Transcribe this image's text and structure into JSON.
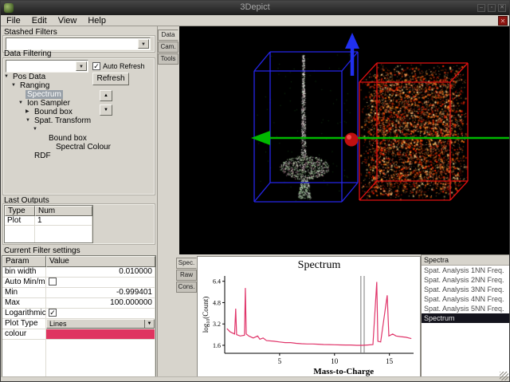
{
  "window": {
    "title": "3Depict"
  },
  "menu": {
    "items": [
      "File",
      "Edit",
      "View",
      "Help"
    ]
  },
  "icons": {
    "close": "✕",
    "minimize": "–",
    "maximize": "▫",
    "dropdown": "▼",
    "up": "▲",
    "down": "▼",
    "check": "✓",
    "tree_expanded": "▼",
    "tree_collapsed": "▶"
  },
  "left_panel": {
    "stashed_filters": {
      "label": "Stashed Filters"
    },
    "data_filtering": {
      "label": "Data Filtering",
      "auto_refresh_label": "Auto Refresh",
      "auto_refresh_checked": true,
      "refresh_label": "Refresh"
    },
    "tree": {
      "items": [
        {
          "label": "Pos Data",
          "indent": 0,
          "arrow": "down",
          "selected": false
        },
        {
          "label": "Ranging",
          "indent": 1,
          "arrow": "down",
          "selected": false
        },
        {
          "label": "Spectrum",
          "indent": 2,
          "arrow": "none",
          "selected": true
        },
        {
          "label": "Ion Sampler",
          "indent": 2,
          "arrow": "down",
          "selected": false
        },
        {
          "label": "Bound box",
          "indent": 3,
          "arrow": "right",
          "selected": false
        },
        {
          "label": "Spat. Transform",
          "indent": 3,
          "arrow": "down",
          "selected": false
        },
        {
          "label": "",
          "indent": 4,
          "arrow": "down",
          "selected": false
        },
        {
          "label": "Bound box",
          "indent": 5,
          "arrow": "none",
          "selected": false
        },
        {
          "label": "Spectral Colour",
          "indent": 6,
          "arrow": "none",
          "selected": false
        },
        {
          "label": "RDF",
          "indent": 3,
          "arrow": "none",
          "selected": false
        }
      ]
    },
    "last_outputs": {
      "label": "Last Outputs",
      "columns": [
        "Type",
        "Num"
      ],
      "rows": [
        [
          "Plot",
          "1"
        ]
      ]
    },
    "filter_settings": {
      "label": "Current Filter settings",
      "columns": [
        "Param",
        "Value"
      ],
      "rows": [
        {
          "param": "bin width",
          "type": "text",
          "value": "0.010000"
        },
        {
          "param": "Auto Min/max",
          "type": "checkbox",
          "checked": false
        },
        {
          "param": "Min",
          "type": "text",
          "value": "-0.999401"
        },
        {
          "param": "Max",
          "type": "text",
          "value": "100.000000"
        },
        {
          "param": "Logarithmic",
          "type": "checkbox",
          "checked": true
        },
        {
          "param": "Plot Type",
          "type": "dropdown",
          "value": "Lines"
        },
        {
          "param": "colour",
          "type": "color",
          "color": "#df3560"
        }
      ]
    }
  },
  "right_tabs": {
    "items": [
      "Data",
      "Cam.",
      "Tools"
    ],
    "active": "Data"
  },
  "plot_tabs": {
    "items": [
      "Spec.",
      "Raw",
      "Cons."
    ],
    "active": "Spec."
  },
  "spectra_panel": {
    "header": "Spectra",
    "items": [
      "Spat. Analysis 1NN Freq.",
      "Spat. Analysis 2NN Freq.",
      "Spat. Analysis 3NN Freq.",
      "Spat. Analysis 4NN Freq.",
      "Spat. Analysis 5NN Freq."
    ],
    "selected": "Spectrum"
  },
  "chart_data": {
    "type": "line",
    "title": "Spectrum",
    "xlabel": "Mass-to-Charge",
    "ylabel": {
      "prefix": "log",
      "sub": "10",
      "suffix": "(Count)"
    },
    "xlim": [
      0,
      17.2
    ],
    "ylim": [
      1.0,
      6.8
    ],
    "xticks": [
      5,
      10,
      15
    ],
    "yticks": [
      1.6,
      3.2,
      4.8,
      6.4
    ],
    "line_color": "#e0356a",
    "cursor_lines": [
      12.4,
      12.7
    ],
    "series": [
      {
        "name": "Spectrum",
        "points": [
          [
            0.2,
            2.85
          ],
          [
            0.5,
            2.6
          ],
          [
            0.9,
            2.45
          ],
          [
            1.0,
            4.35
          ],
          [
            1.08,
            2.4
          ],
          [
            1.4,
            2.3
          ],
          [
            1.8,
            2.35
          ],
          [
            1.88,
            5.9
          ],
          [
            1.96,
            2.45
          ],
          [
            2.2,
            2.3
          ],
          [
            2.6,
            2.15
          ],
          [
            3.0,
            2.3
          ],
          [
            3.2,
            2.05
          ],
          [
            3.5,
            2.15
          ],
          [
            3.8,
            1.95
          ],
          [
            4.5,
            1.9
          ],
          [
            5.0,
            1.85
          ],
          [
            5.5,
            1.8
          ],
          [
            6.0,
            1.8
          ],
          [
            6.5,
            1.75
          ],
          [
            7.0,
            1.72
          ],
          [
            7.5,
            1.7
          ],
          [
            8.0,
            1.7
          ],
          [
            8.5,
            1.68
          ],
          [
            9.0,
            1.66
          ],
          [
            9.5,
            1.65
          ],
          [
            10.0,
            1.64
          ],
          [
            10.5,
            1.63
          ],
          [
            11.0,
            1.62
          ],
          [
            11.5,
            1.62
          ],
          [
            12.0,
            1.6
          ],
          [
            12.5,
            1.6
          ],
          [
            13.0,
            1.62
          ],
          [
            13.5,
            1.65
          ],
          [
            13.85,
            6.35
          ],
          [
            13.95,
            1.9
          ],
          [
            14.2,
            1.85
          ],
          [
            14.8,
            5.35
          ],
          [
            14.95,
            2.3
          ],
          [
            15.3,
            2.45
          ],
          [
            15.6,
            2.3
          ],
          [
            16.0,
            2.25
          ],
          [
            16.5,
            2.2
          ],
          [
            17.0,
            2.1
          ]
        ]
      }
    ]
  },
  "scene": {
    "background": "#000000",
    "left_box_color": "#2525e8",
    "right_box_color": "#e01010",
    "x_arrow_color": "#00b800",
    "z_arrow_color": "#2030f0",
    "origin_color": "#c01010",
    "cloud_colors": [
      "#ff5a00",
      "#ff2600",
      "#ffa030",
      "#ffd890",
      "#b81800",
      "#ff8844"
    ],
    "spike_colors": [
      "#ffffff",
      "#cfe8c8",
      "#e8b8c8"
    ],
    "cap_colors": [
      "#bfe8b0",
      "#ffffff",
      "#e8a8c0",
      "#88c888"
    ]
  }
}
